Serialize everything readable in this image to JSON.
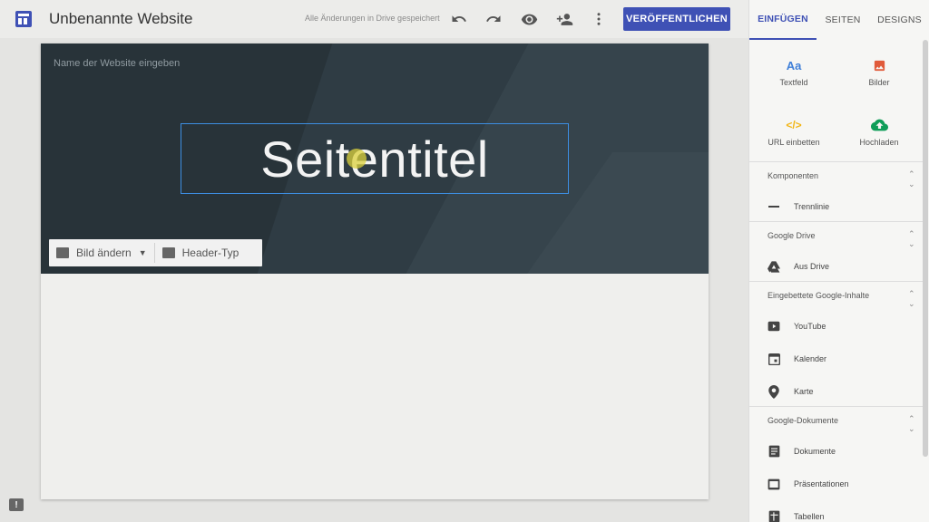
{
  "topbar": {
    "site_title": "Unbenannte Website",
    "save_status": "Alle Änderungen in Drive gespeichert",
    "publish_label": "VERÖFFENTLICHEN",
    "icons": [
      "undo-icon",
      "redo-icon",
      "preview-icon",
      "share-icon",
      "more-icon"
    ]
  },
  "header": {
    "site_name_placeholder": "Name der Website eingeben",
    "page_title": "Seitentitel",
    "change_image_label": "Bild ändern",
    "header_type_label": "Header-Typ"
  },
  "panel": {
    "tabs": [
      {
        "label": "EINFÜGEN",
        "active": true
      },
      {
        "label": "SEITEN",
        "active": false
      },
      {
        "label": "DESIGNS",
        "active": false
      }
    ],
    "quick_insert": [
      {
        "label": "Textfeld",
        "icon": "text-icon",
        "glyph": "Aa",
        "color": "#3f7fd8"
      },
      {
        "label": "Bilder",
        "icon": "image-icon",
        "color": "#e05a3a"
      },
      {
        "label": "URL einbetten",
        "icon": "embed-icon",
        "glyph": "</>",
        "color": "#f2b515"
      },
      {
        "label": "Hochladen",
        "icon": "upload-icon",
        "color": "#0f9d58"
      }
    ],
    "sections": [
      {
        "title": "Komponenten",
        "items": [
          "Trennlinie"
        ]
      },
      {
        "title": "Google Drive",
        "items": [
          "Aus Drive"
        ]
      },
      {
        "title": "Eingebettete Google-Inhalte",
        "items": [
          "YouTube",
          "Kalender",
          "Karte"
        ]
      },
      {
        "title": "Google-Dokumente",
        "items": [
          "Dokumente",
          "Präsentationen",
          "Tabellen"
        ]
      }
    ]
  },
  "colors": {
    "accent": "#3f51b5",
    "selection": "#3d8ee2",
    "header_bg": "#2f3c44"
  }
}
